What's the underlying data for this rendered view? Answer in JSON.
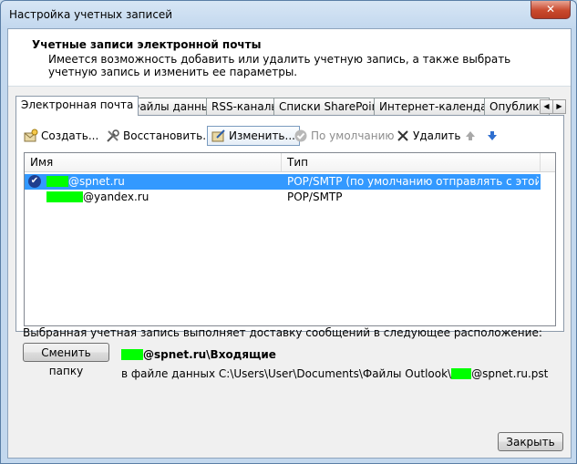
{
  "window": {
    "title": "Настройка учетных записей",
    "close_label": "✕"
  },
  "header": {
    "title": "Учетные записи электронной почты",
    "description": "Имеется возможность добавить или удалить учетную запись, а также выбрать учетную запись и изменить ее параметры."
  },
  "tabs": [
    {
      "label": "Электронная почта",
      "active": true
    },
    {
      "label": "Файлы данных"
    },
    {
      "label": "RSS-каналы"
    },
    {
      "label": "Списки SharePoint"
    },
    {
      "label": "Интернет-календари"
    },
    {
      "label": "Опубликованн"
    }
  ],
  "toolbar": {
    "create": "Создать...",
    "restore": "Восстановить...",
    "change": "Изменить...",
    "default": "По умолчанию",
    "delete": "Удалить"
  },
  "list": {
    "col_name": "Имя",
    "col_type": "Тип",
    "rows": [
      {
        "name": "@spnet.ru",
        "type": "POP/SMTP (по умолчанию отправлять с этой учет...",
        "selected": true
      },
      {
        "name": "@yandex.ru",
        "type": "POP/SMTP",
        "selected": false
      }
    ]
  },
  "footer": {
    "delivery_text": "Выбранная учетная запись выполняет доставку сообщений в следующее расположение:",
    "change_folder_button": "Сменить папку",
    "folder_path": "@spnet.ru\\Входящие",
    "file_prefix": "в файле данных C:\\Users\\User\\Documents\\Файлы Outlook\\",
    "file_suffix": "@spnet.ru.pst",
    "close_button": "Закрыть"
  },
  "colors": {
    "selection": "#3399ff",
    "redacted": "#00ff00"
  }
}
